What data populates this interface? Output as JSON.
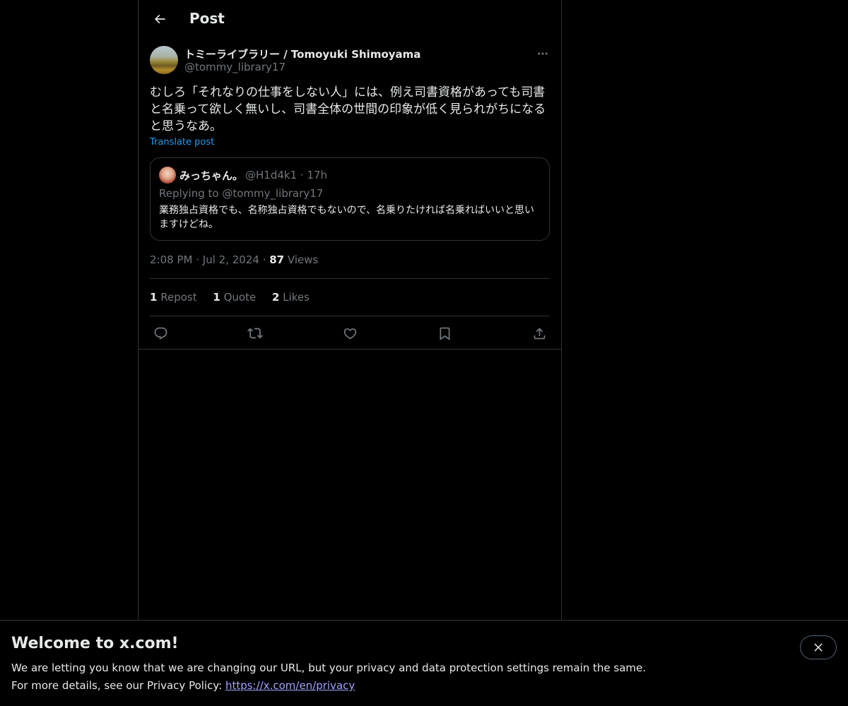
{
  "header": {
    "title": "Post",
    "back_icon": "arrow-left-icon"
  },
  "post": {
    "author_name": "トミーライブラリー / Tomoyuki Shimoyama",
    "author_handle": "@tommy_library17",
    "text": "むしろ「それなりの仕事をしない人」には、例え司書資格があっても司書と名乗って欲しく無いし、司書全体の世間の印象が低く見られがちになると思うなあ。",
    "translate_label": "Translate post",
    "time": "2:08 PM",
    "date": "Jul 2, 2024",
    "views_count": "87",
    "views_label": "Views"
  },
  "quote": {
    "name": "みっちゃん。",
    "handle": "@H1d4k1",
    "age": "17h",
    "replying_to": "Replying to @tommy_library17",
    "text": "業務独占資格でも、名称独占資格でもないので、名乗りたければ名乗ればいいと思いますけどね。"
  },
  "stats": {
    "reposts_count": "1",
    "reposts_label": "Repost",
    "quotes_count": "1",
    "quotes_label": "Quote",
    "likes_count": "2",
    "likes_label": "Likes"
  },
  "actions": [
    "reply-icon",
    "repost-icon",
    "like-icon",
    "bookmark-icon",
    "share-icon"
  ],
  "banner": {
    "title": "Welcome to x.com!",
    "line1": "We are letting you know that we are changing our URL, but your privacy and data protection settings remain the same.",
    "line2_prefix": "For more details, see our Privacy Policy: ",
    "link": "https://x.com/en/privacy"
  },
  "colors": {
    "background": "#000000",
    "text": "#e7e9ea",
    "muted": "#71767b",
    "accent": "#1d9bf0",
    "border": "#2f3336"
  }
}
